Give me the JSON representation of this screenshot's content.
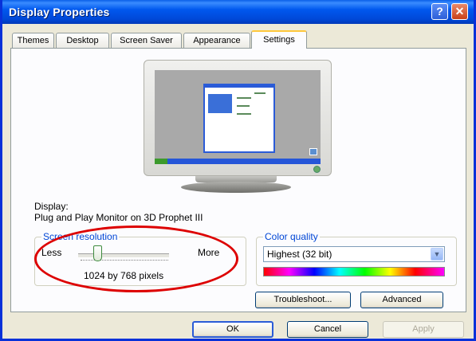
{
  "window": {
    "title": "Display Properties",
    "help_label": "?",
    "close_label": "✕"
  },
  "tabs": [
    {
      "label": "Themes"
    },
    {
      "label": "Desktop"
    },
    {
      "label": "Screen Saver"
    },
    {
      "label": "Appearance"
    },
    {
      "label": "Settings",
      "active": true
    }
  ],
  "display": {
    "heading": "Display:",
    "monitor_name": "Plug and Play Monitor on 3D Prophet III"
  },
  "resolution": {
    "group_label": "Screen resolution",
    "less_label": "Less",
    "more_label": "More",
    "value_text": "1024 by 768 pixels"
  },
  "color_quality": {
    "group_label": "Color quality",
    "selected": "Highest (32 bit)"
  },
  "buttons": {
    "troubleshoot": "Troubleshoot...",
    "advanced": "Advanced",
    "ok": "OK",
    "cancel": "Cancel",
    "apply": "Apply"
  },
  "icons": {
    "help": "help-icon",
    "close": "close-icon",
    "dropdown": "chevron-down-icon",
    "monitor": "monitor-icon"
  },
  "colors": {
    "titlebar": "#0058ee",
    "highlight": "#dd0000",
    "group_label": "#0046d5"
  }
}
